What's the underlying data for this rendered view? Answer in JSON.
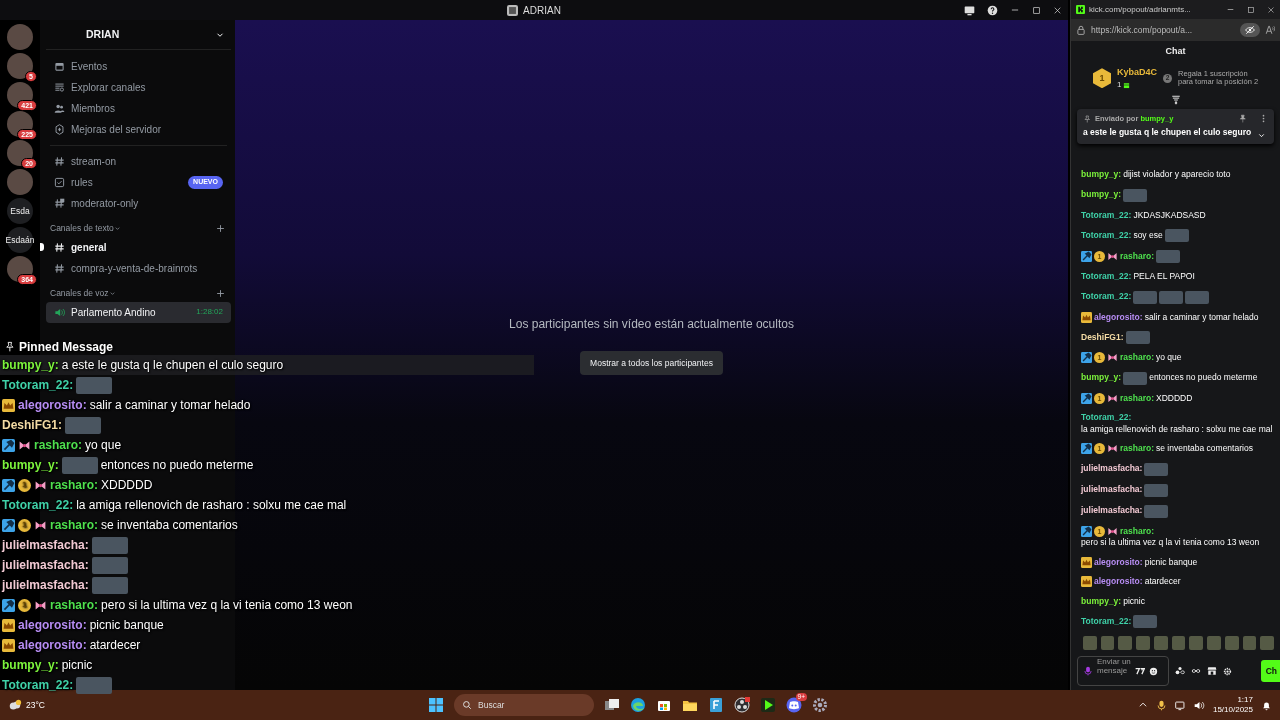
{
  "app_title_bar": {
    "title": "ADRIAN"
  },
  "server_rail": [
    {
      "kind": "image"
    },
    {
      "kind": "image",
      "badge": "5"
    },
    {
      "kind": "image",
      "badge": "421"
    },
    {
      "kind": "image",
      "badge": "225"
    },
    {
      "kind": "image",
      "badge": "20"
    },
    {
      "kind": "image"
    },
    {
      "kind": "text",
      "label": "Esda"
    },
    {
      "kind": "text",
      "label": "Esdaán"
    },
    {
      "kind": "image",
      "badge": "364"
    }
  ],
  "server": {
    "name": "DRIAN",
    "menu": [
      {
        "kind": "calendar",
        "label": "Eventos"
      },
      {
        "kind": "browse",
        "label": "Explorar canales"
      },
      {
        "kind": "members",
        "label": "Miembros"
      },
      {
        "kind": "boost",
        "label": "Mejoras del servidor"
      }
    ],
    "channels": [
      {
        "kind": "text",
        "name": "stream-on",
        "selected": false,
        "unread": false
      },
      {
        "kind": "rules",
        "name": "rules",
        "tag": "NUEVO",
        "selected": false,
        "unread": false
      },
      {
        "kind": "locked",
        "name": "moderator-only",
        "selected": false,
        "unread": false
      }
    ],
    "categories": [
      {
        "name": "Canales de texto",
        "channels": [
          {
            "kind": "text",
            "name": "general",
            "selected": false,
            "unread": true
          },
          {
            "kind": "text",
            "name": "compra-y-venta-de-brainrots",
            "selected": false,
            "unread": false
          }
        ]
      },
      {
        "name": "Canales de voz",
        "channels": [
          {
            "kind": "voice",
            "name": "Parlamento Andino",
            "time": "1:28:02",
            "selected": true,
            "unread": false
          }
        ]
      }
    ]
  },
  "stage": {
    "notice": "Los participantes sin vídeo están actualmente ocultos",
    "button": "Mostrar a todos los participantes"
  },
  "overlay_chat": {
    "title": "Pinned Message",
    "messages": [
      {
        "user": "bumpy_y:",
        "color": "#7cf33c",
        "parts": [
          {
            "kind": "text",
            "text": "a este le gusta q le chupen el culo seguro"
          }
        ]
      },
      {
        "user": "Totoram_22:",
        "color": "#3fd1a8",
        "parts": [
          {
            "kind": "emote"
          }
        ]
      },
      {
        "user": "alegorosito:",
        "color": "#b68cf2",
        "badges": [
          {
            "kind": "crown"
          }
        ],
        "parts": [
          {
            "kind": "text",
            "text": "salir a caminar y tomar helado"
          }
        ]
      },
      {
        "user": "DeshiFG1:",
        "color": "#f3dba4",
        "parts": [
          {
            "kind": "emote"
          }
        ]
      },
      {
        "user": "rasharo:",
        "color": "#4ee04e",
        "badges": [
          {
            "kind": "moderator"
          },
          {
            "kind": "bow"
          }
        ],
        "parts": [
          {
            "kind": "text",
            "text": "yo que"
          }
        ]
      },
      {
        "user": "bumpy_y:",
        "color": "#7cf33c",
        "parts": [
          {
            "kind": "emote"
          },
          {
            "kind": "text",
            "text": "entonces no puedo meterme"
          }
        ]
      },
      {
        "user": "rasharo:",
        "color": "#4ee04e",
        "badges": [
          {
            "kind": "moderator"
          },
          {
            "kind": "gifter",
            "label": "1"
          },
          {
            "kind": "bow"
          }
        ],
        "parts": [
          {
            "kind": "text",
            "text": "XDDDDD"
          }
        ]
      },
      {
        "user": "Totoram_22:",
        "color": "#3fd1a8",
        "parts": [
          {
            "kind": "text",
            "text": "la amiga rellenovich de rasharo : solxu me cae mal"
          }
        ]
      },
      {
        "user": "rasharo:",
        "color": "#4ee04e",
        "badges": [
          {
            "kind": "moderator"
          },
          {
            "kind": "gifter",
            "label": "1"
          },
          {
            "kind": "bow"
          }
        ],
        "parts": [
          {
            "kind": "text",
            "text": "se inventaba comentarios"
          }
        ]
      },
      {
        "user": "julielmasfacha:",
        "color": "#f2c9d3",
        "parts": [
          {
            "kind": "emote"
          }
        ]
      },
      {
        "user": "julielmasfacha:",
        "color": "#f2c9d3",
        "parts": [
          {
            "kind": "emote"
          }
        ]
      },
      {
        "user": "julielmasfacha:",
        "color": "#f2c9d3",
        "parts": [
          {
            "kind": "emote"
          }
        ]
      },
      {
        "user": "rasharo:",
        "color": "#4ee04e",
        "badges": [
          {
            "kind": "moderator"
          },
          {
            "kind": "gifter",
            "label": "1"
          },
          {
            "kind": "bow"
          }
        ],
        "parts": [
          {
            "kind": "text",
            "text": "pero si la ultima vez q la vi tenia como 13 weon"
          }
        ]
      },
      {
        "user": "alegorosito:",
        "color": "#b68cf2",
        "badges": [
          {
            "kind": "crown"
          }
        ],
        "parts": [
          {
            "kind": "text",
            "text": "picnic banque"
          }
        ]
      },
      {
        "user": "alegorosito:",
        "color": "#b68cf2",
        "badges": [
          {
            "kind": "crown"
          }
        ],
        "parts": [
          {
            "kind": "text",
            "text": "atardecer"
          }
        ]
      },
      {
        "user": "bumpy_y:",
        "color": "#7cf33c",
        "parts": [
          {
            "kind": "text",
            "text": "picnic"
          }
        ]
      },
      {
        "user": "Totoram_22:",
        "color": "#3fd1a8",
        "parts": [
          {
            "kind": "emote"
          }
        ]
      }
    ]
  },
  "browser": {
    "tab_title": "kick.com/popout/adrianmts...",
    "url": "https://kick.com/popout/a..."
  },
  "kick_chat": {
    "title": "Chat",
    "leaderboard": {
      "rank": "1",
      "user": "KybaD4C",
      "count": "1",
      "next_rank": "2",
      "prompt": "Regala 1 suscripción para tomar la posición 2"
    },
    "pinned": {
      "label": "Enviado por",
      "user": "bumpy_y",
      "text": "a este le gusta q le chupen el culo seguro"
    },
    "messages": [
      {
        "user": "bumpy_y:",
        "color": "#7cf33c",
        "parts": [
          {
            "kind": "text",
            "text": "dijist violador y aparecio toto"
          }
        ]
      },
      {
        "user": "bumpy_y:",
        "color": "#7cf33c",
        "parts": [
          {
            "kind": "emote"
          }
        ]
      },
      {
        "user": "Totoram_22:",
        "color": "#3fd1a8",
        "parts": [
          {
            "kind": "text",
            "text": "JKDASJKADSASD"
          }
        ]
      },
      {
        "user": "Totoram_22:",
        "color": "#3fd1a8",
        "parts": [
          {
            "kind": "text",
            "text": "soy ese"
          },
          {
            "kind": "emote"
          }
        ]
      },
      {
        "user": "rasharo:",
        "color": "#4ee04e",
        "badges": [
          {
            "kind": "moderator"
          },
          {
            "kind": "gifter",
            "label": "1"
          },
          {
            "kind": "bow"
          }
        ],
        "parts": [
          {
            "kind": "emote"
          }
        ]
      },
      {
        "user": "Totoram_22:",
        "color": "#3fd1a8",
        "parts": [
          {
            "kind": "text",
            "text": "PELA EL PAPOI"
          }
        ]
      },
      {
        "user": "Totoram_22:",
        "color": "#3fd1a8",
        "parts": [
          {
            "kind": "emote"
          },
          {
            "kind": "emote"
          },
          {
            "kind": "emote"
          }
        ]
      },
      {
        "user": "alegorosito:",
        "color": "#b68cf2",
        "badges": [
          {
            "kind": "crown"
          }
        ],
        "parts": [
          {
            "kind": "text",
            "text": "salir a caminar y tomar helado"
          }
        ]
      },
      {
        "user": "DeshiFG1:",
        "color": "#f3dba4",
        "parts": [
          {
            "kind": "emote"
          }
        ]
      },
      {
        "user": "rasharo:",
        "color": "#4ee04e",
        "badges": [
          {
            "kind": "moderator"
          },
          {
            "kind": "gifter",
            "label": "1"
          },
          {
            "kind": "bow"
          }
        ],
        "parts": [
          {
            "kind": "text",
            "text": "yo que"
          }
        ]
      },
      {
        "user": "bumpy_y:",
        "color": "#7cf33c",
        "parts": [
          {
            "kind": "emote"
          },
          {
            "kind": "text",
            "text": "entonces no puedo meterme"
          }
        ]
      },
      {
        "user": "rasharo:",
        "color": "#4ee04e",
        "badges": [
          {
            "kind": "moderator"
          },
          {
            "kind": "gifter",
            "label": "1"
          },
          {
            "kind": "bow"
          }
        ],
        "parts": [
          {
            "kind": "text",
            "text": "XDDDDD"
          }
        ]
      },
      {
        "user": "Totoram_22:",
        "color": "#3fd1a8",
        "parts": [
          {
            "kind": "text",
            "text": "la amiga rellenovich de rasharo : solxu me cae mal"
          }
        ]
      },
      {
        "user": "rasharo:",
        "color": "#4ee04e",
        "badges": [
          {
            "kind": "moderator"
          },
          {
            "kind": "gifter",
            "label": "1"
          },
          {
            "kind": "bow"
          }
        ],
        "parts": [
          {
            "kind": "text",
            "text": "se inventaba comentarios"
          }
        ]
      },
      {
        "user": "julielmasfacha:",
        "color": "#f2c9d3",
        "parts": [
          {
            "kind": "emote"
          }
        ]
      },
      {
        "user": "julielmasfacha:",
        "color": "#f2c9d3",
        "parts": [
          {
            "kind": "emote"
          }
        ]
      },
      {
        "user": "julielmasfacha:",
        "color": "#f2c9d3",
        "parts": [
          {
            "kind": "emote"
          }
        ]
      },
      {
        "user": "rasharo:",
        "color": "#4ee04e",
        "badges": [
          {
            "kind": "moderator"
          },
          {
            "kind": "gifter",
            "label": "1"
          },
          {
            "kind": "bow"
          }
        ],
        "parts": [
          {
            "kind": "text",
            "text": "pero si la ultima vez q la vi tenia como 13 weon"
          }
        ]
      },
      {
        "user": "alegorosito:",
        "color": "#b68cf2",
        "badges": [
          {
            "kind": "crown"
          }
        ],
        "parts": [
          {
            "kind": "text",
            "text": "picnic banque"
          }
        ]
      },
      {
        "user": "alegorosito:",
        "color": "#b68cf2",
        "badges": [
          {
            "kind": "crown"
          }
        ],
        "parts": [
          {
            "kind": "text",
            "text": "atardecer"
          }
        ]
      },
      {
        "user": "bumpy_y:",
        "color": "#7cf33c",
        "parts": [
          {
            "kind": "text",
            "text": "picnic"
          }
        ]
      },
      {
        "user": "Totoram_22:",
        "color": "#3fd1a8",
        "parts": [
          {
            "kind": "emote"
          }
        ]
      }
    ],
    "input": {
      "placeholder": "Enviar un mensaje"
    },
    "send_button": "Ch"
  },
  "taskbar": {
    "temperature": "23°C",
    "search_placeholder": "Buscar",
    "discord_badge": "9+",
    "time": "1:17",
    "date": "15/10/2025"
  }
}
